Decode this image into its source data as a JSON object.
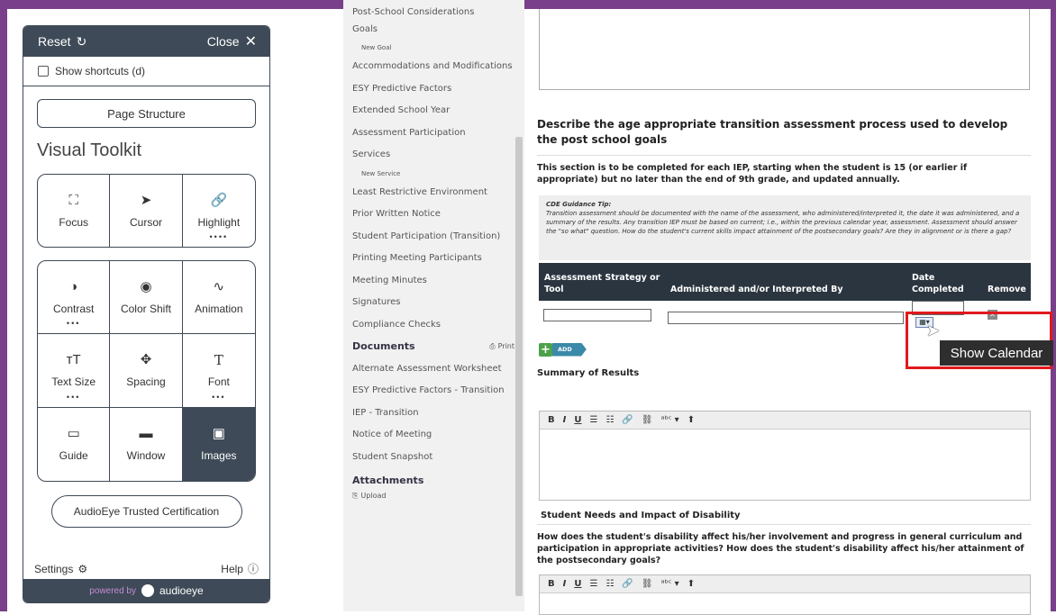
{
  "toolkit": {
    "reset_label": "Reset",
    "close_label": "Close",
    "show_shortcuts_label": "Show shortcuts (d)",
    "page_structure_label": "Page Structure",
    "title": "Visual Toolkit",
    "tools_row1": [
      {
        "label": "Focus",
        "icon": "focus-icon"
      },
      {
        "label": "Cursor",
        "icon": "cursor-icon"
      },
      {
        "label": "Highlight",
        "icon": "link-icon",
        "dots": "••••"
      }
    ],
    "tools_grid": [
      {
        "label": "Contrast",
        "icon": "contrast-icon",
        "dots": "•••"
      },
      {
        "label": "Color Shift",
        "icon": "color-shift-icon"
      },
      {
        "label": "Animation",
        "icon": "animation-icon"
      },
      {
        "label": "Text Size",
        "icon": "text-size-icon",
        "dots": "•••"
      },
      {
        "label": "Spacing",
        "icon": "spacing-icon"
      },
      {
        "label": "Font",
        "icon": "font-icon",
        "dots": "•••"
      },
      {
        "label": "Guide",
        "icon": "guide-icon"
      },
      {
        "label": "Window",
        "icon": "window-icon"
      },
      {
        "label": "Images",
        "icon": "images-icon",
        "active": true
      }
    ],
    "certification_label": "AudioEye Trusted Certification",
    "settings_label": "Settings",
    "help_label": "Help",
    "powered_by": "powered by",
    "brand": "audioeye"
  },
  "nav": {
    "items": [
      {
        "label": "Post-School Considerations",
        "type": "item"
      },
      {
        "label": "Goals",
        "type": "item"
      },
      {
        "label": "New Goal",
        "type": "sub"
      },
      {
        "label": "Accommodations and Modifications",
        "type": "item"
      },
      {
        "label": "ESY Predictive Factors",
        "type": "item"
      },
      {
        "label": "Extended School Year",
        "type": "item"
      },
      {
        "label": "Assessment Participation",
        "type": "item"
      },
      {
        "label": "Services",
        "type": "item"
      },
      {
        "label": "New Service",
        "type": "sub"
      },
      {
        "label": "Least Restrictive Environment",
        "type": "item"
      },
      {
        "label": "Prior Written Notice",
        "type": "item"
      },
      {
        "label": "Student Participation (Transition)",
        "type": "item"
      },
      {
        "label": "Printing Meeting Participants",
        "type": "item"
      },
      {
        "label": "Meeting Minutes",
        "type": "item"
      },
      {
        "label": "Signatures",
        "type": "item"
      },
      {
        "label": "Compliance Checks",
        "type": "item"
      }
    ],
    "documents_heading": "Documents",
    "print_label": "Print",
    "documents": [
      "Alternate Assessment Worksheet",
      "ESY Predictive Factors - Transition",
      "IEP - Transition",
      "Notice of Meeting",
      "Student Snapshot"
    ],
    "attachments_heading": "Attachments",
    "upload_label": "Upload"
  },
  "main": {
    "section_title": "Describe the age appropriate transition assessment process used to develop the post school goals",
    "instructions": "This section is to be completed for each IEP, starting when the student is 15 (or earlier if appropriate) but no later than the end of 9th grade, and updated annually.",
    "guidance_title": "CDE Guidance Tip:",
    "guidance_text": "Transition assessment should be documented with the name of the assessment, who administered/interpreted it, the date it was administered, and a summary of the results. Any transition IEP must be based on current; i.e., within the previous calendar year, assessment. Assessment should answer the \"so what\" question. How do the student's current skills impact attainment of the postsecondary goals? Are they in alignment or is there a gap?",
    "table_headers": {
      "strategy": "Assessment Strategy or Tool",
      "administered": "Administered and/or Interpreted By",
      "date": "Date Completed",
      "remove": "Remove"
    },
    "add_label": "ADD",
    "tooltip": "Show Calendar",
    "summary_label": "Summary of Results",
    "student_needs_label": "Student Needs and Impact of Disability",
    "question": "How does the student's disability affect his/her involvement and progress in general curriculum and participation in appropriate activities? How does the student's disability affect his/her attainment of the postsecondary goals?",
    "editor_tools": [
      "B",
      "I",
      "U",
      "☰",
      "☷",
      "🔗",
      "⛓",
      "ᵃᵇᶜ ▾",
      "⬆"
    ]
  },
  "colors": {
    "frame": "#7a3f8a",
    "toolkit_dark": "#3e4a57",
    "table_header": "#2b3540",
    "highlight_red": "#e0191e"
  }
}
